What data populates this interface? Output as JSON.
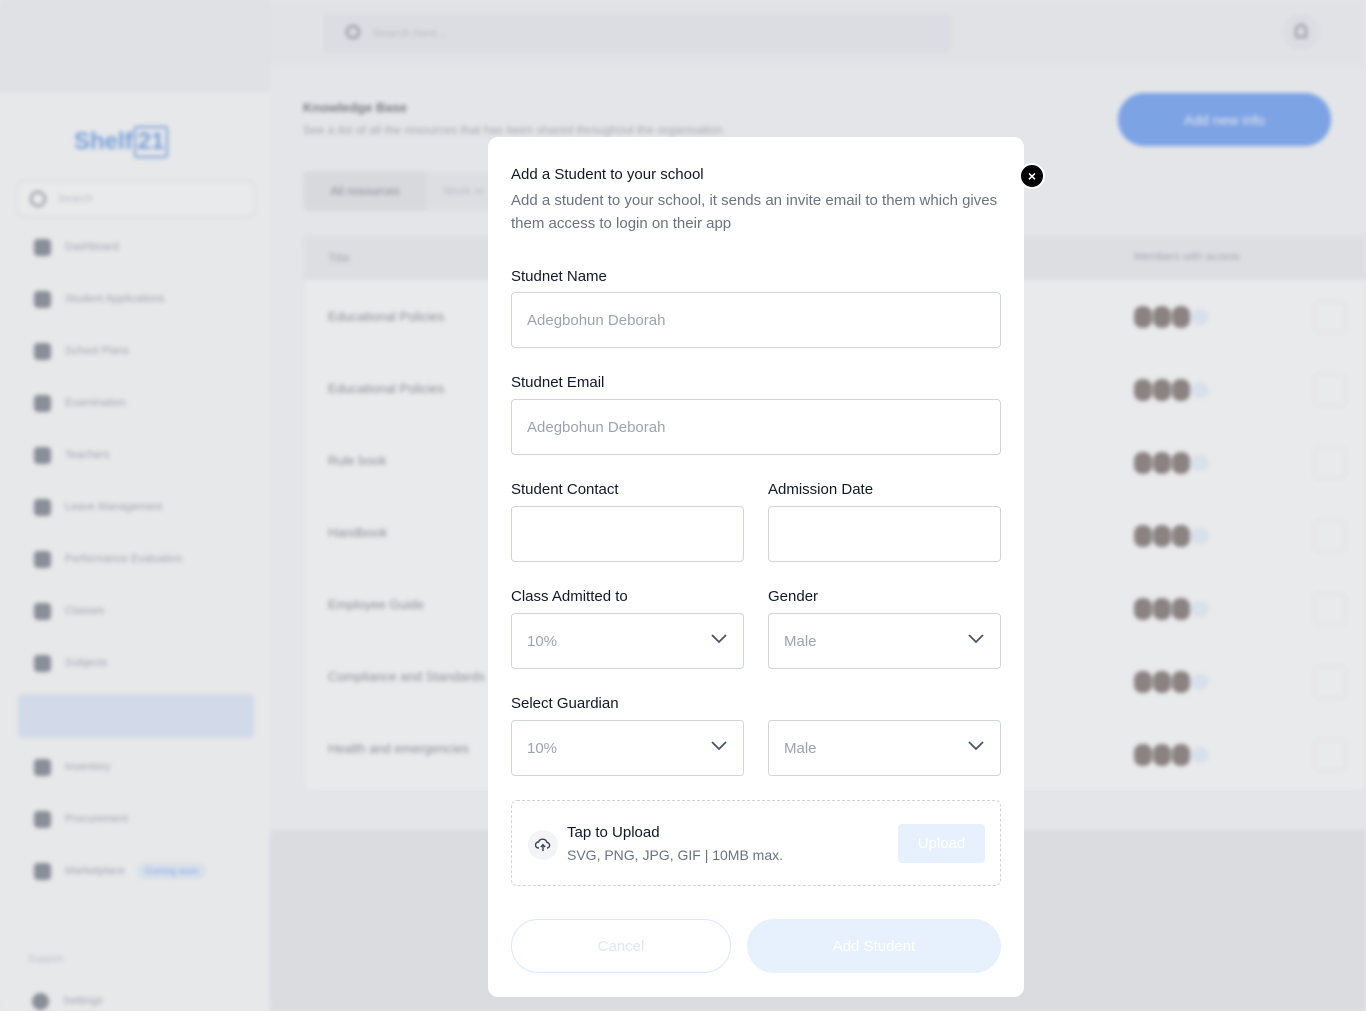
{
  "background": {
    "logo_text": "Shelf",
    "logo_box_text": "21",
    "sidebar_search_placeholder": "Search",
    "nav_items": [
      "Dashboard",
      "Student Applications",
      "School Plans",
      "Examination",
      "Teachers",
      "Leave Management",
      "Performance Evaluation",
      "Classes",
      "Subjects",
      "",
      "Inventory",
      "Procurement",
      "Marketplace"
    ],
    "marketplace_badge": "Coming soon",
    "support_label": "Support",
    "settings_label": "Settings",
    "top_search_placeholder": "Search here...",
    "kb_title": "Knowledge Base",
    "kb_subtitle": "See a list of all the resources that has been shared throughout the organisation.",
    "add_info_button": "Add new info",
    "tab_all": "All resources",
    "tab_work": "Work m",
    "col_title": "Title",
    "col_members": "Members with access",
    "rows": [
      "Educational Policies",
      "Educational Policies",
      "Rule book",
      "Handbook",
      "Employee Guide",
      "Compliance and Standards",
      "Health and emergencies"
    ]
  },
  "modal": {
    "title": "Add a Student to your school",
    "description": "Add a student to your school, it sends an invite email to them which gives them access to login on their app",
    "name_label": "Studnet Name",
    "name_value": "Adegbohun Deborah",
    "email_label": "Studnet Email",
    "email_value": "Adegbohun Deborah",
    "contact_label": "Student Contact",
    "contact_value": "",
    "admission_label": "Admission Date",
    "admission_value": "",
    "class_label": "Class Admitted to",
    "class_value": "10%",
    "gender_label": "Gender",
    "gender_value": "Male",
    "guardian_label": "Select Guardian",
    "guardian_value": "10%",
    "guardian_gender_value": "Male",
    "upload_title": "Tap to Upload",
    "upload_sub": "SVG, PNG, JPG, GIF | 10MB max.",
    "upload_button": "Upload",
    "cancel_button": "Cancel",
    "add_button": "Add Student",
    "close_glyph": "×"
  },
  "colors": {
    "accent": "#1d6cf0",
    "disabled_button": "#e7f0fd"
  }
}
